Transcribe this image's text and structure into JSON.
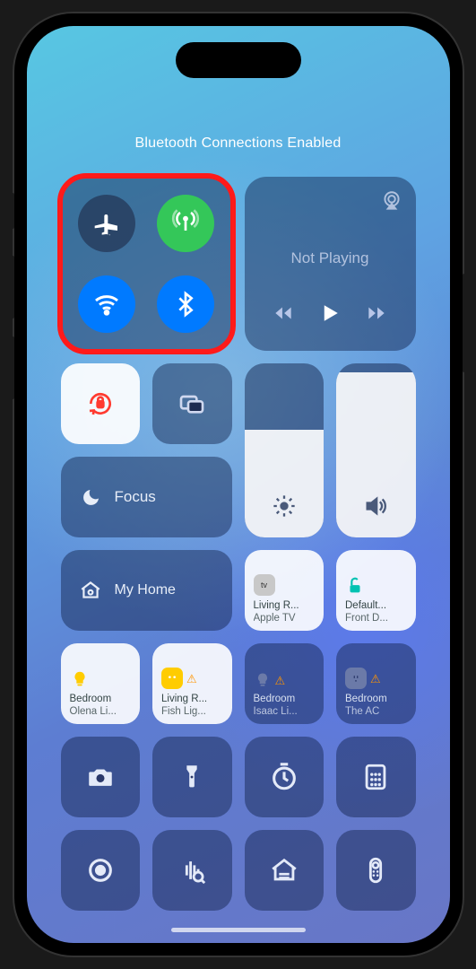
{
  "header": {
    "banner": "Bluetooth Connections Enabled"
  },
  "connectivity": {
    "airplane": false,
    "cellular": true,
    "wifi": true,
    "bluetooth": true
  },
  "highlighted": "connectivity-module",
  "media": {
    "title": "Not Playing"
  },
  "focus": {
    "label": "Focus"
  },
  "sliders": {
    "brightness_pct": 62,
    "volume_pct": 95
  },
  "home": {
    "label": "My Home"
  },
  "devices": [
    {
      "name": "tv-living",
      "line1": "Living R...",
      "line2": "Apple TV",
      "state": "on",
      "icon": "appletv",
      "color": "#7a7a7a"
    },
    {
      "name": "lock-front",
      "line1": "Default...",
      "line2": "Front D...",
      "state": "on",
      "icon": "lock",
      "color": "#00c2b2"
    },
    {
      "name": "light-olena",
      "line1": "Bedroom",
      "line2": "Olena Li...",
      "state": "on",
      "icon": "bulb",
      "color": "#ffcc00"
    },
    {
      "name": "light-fish",
      "line1": "Living R...",
      "line2": "Fish Lig...",
      "state": "on",
      "icon": "bulb",
      "color": "#ffcc00",
      "warn": true
    },
    {
      "name": "light-isaac",
      "line1": "Bedroom",
      "line2": "Isaac Li...",
      "state": "off",
      "icon": "bulb",
      "color": "#3b4a7a",
      "warn": true
    },
    {
      "name": "outlet-ac",
      "line1": "Bedroom",
      "line2": "The AC",
      "state": "off",
      "icon": "outlet",
      "color": "#3b4a7a",
      "warn": true
    }
  ],
  "utilities_row1": [
    "camera",
    "flashlight",
    "timer",
    "calculator"
  ],
  "utilities_row2": [
    "screen-record",
    "shazam",
    "home-app",
    "remote"
  ]
}
